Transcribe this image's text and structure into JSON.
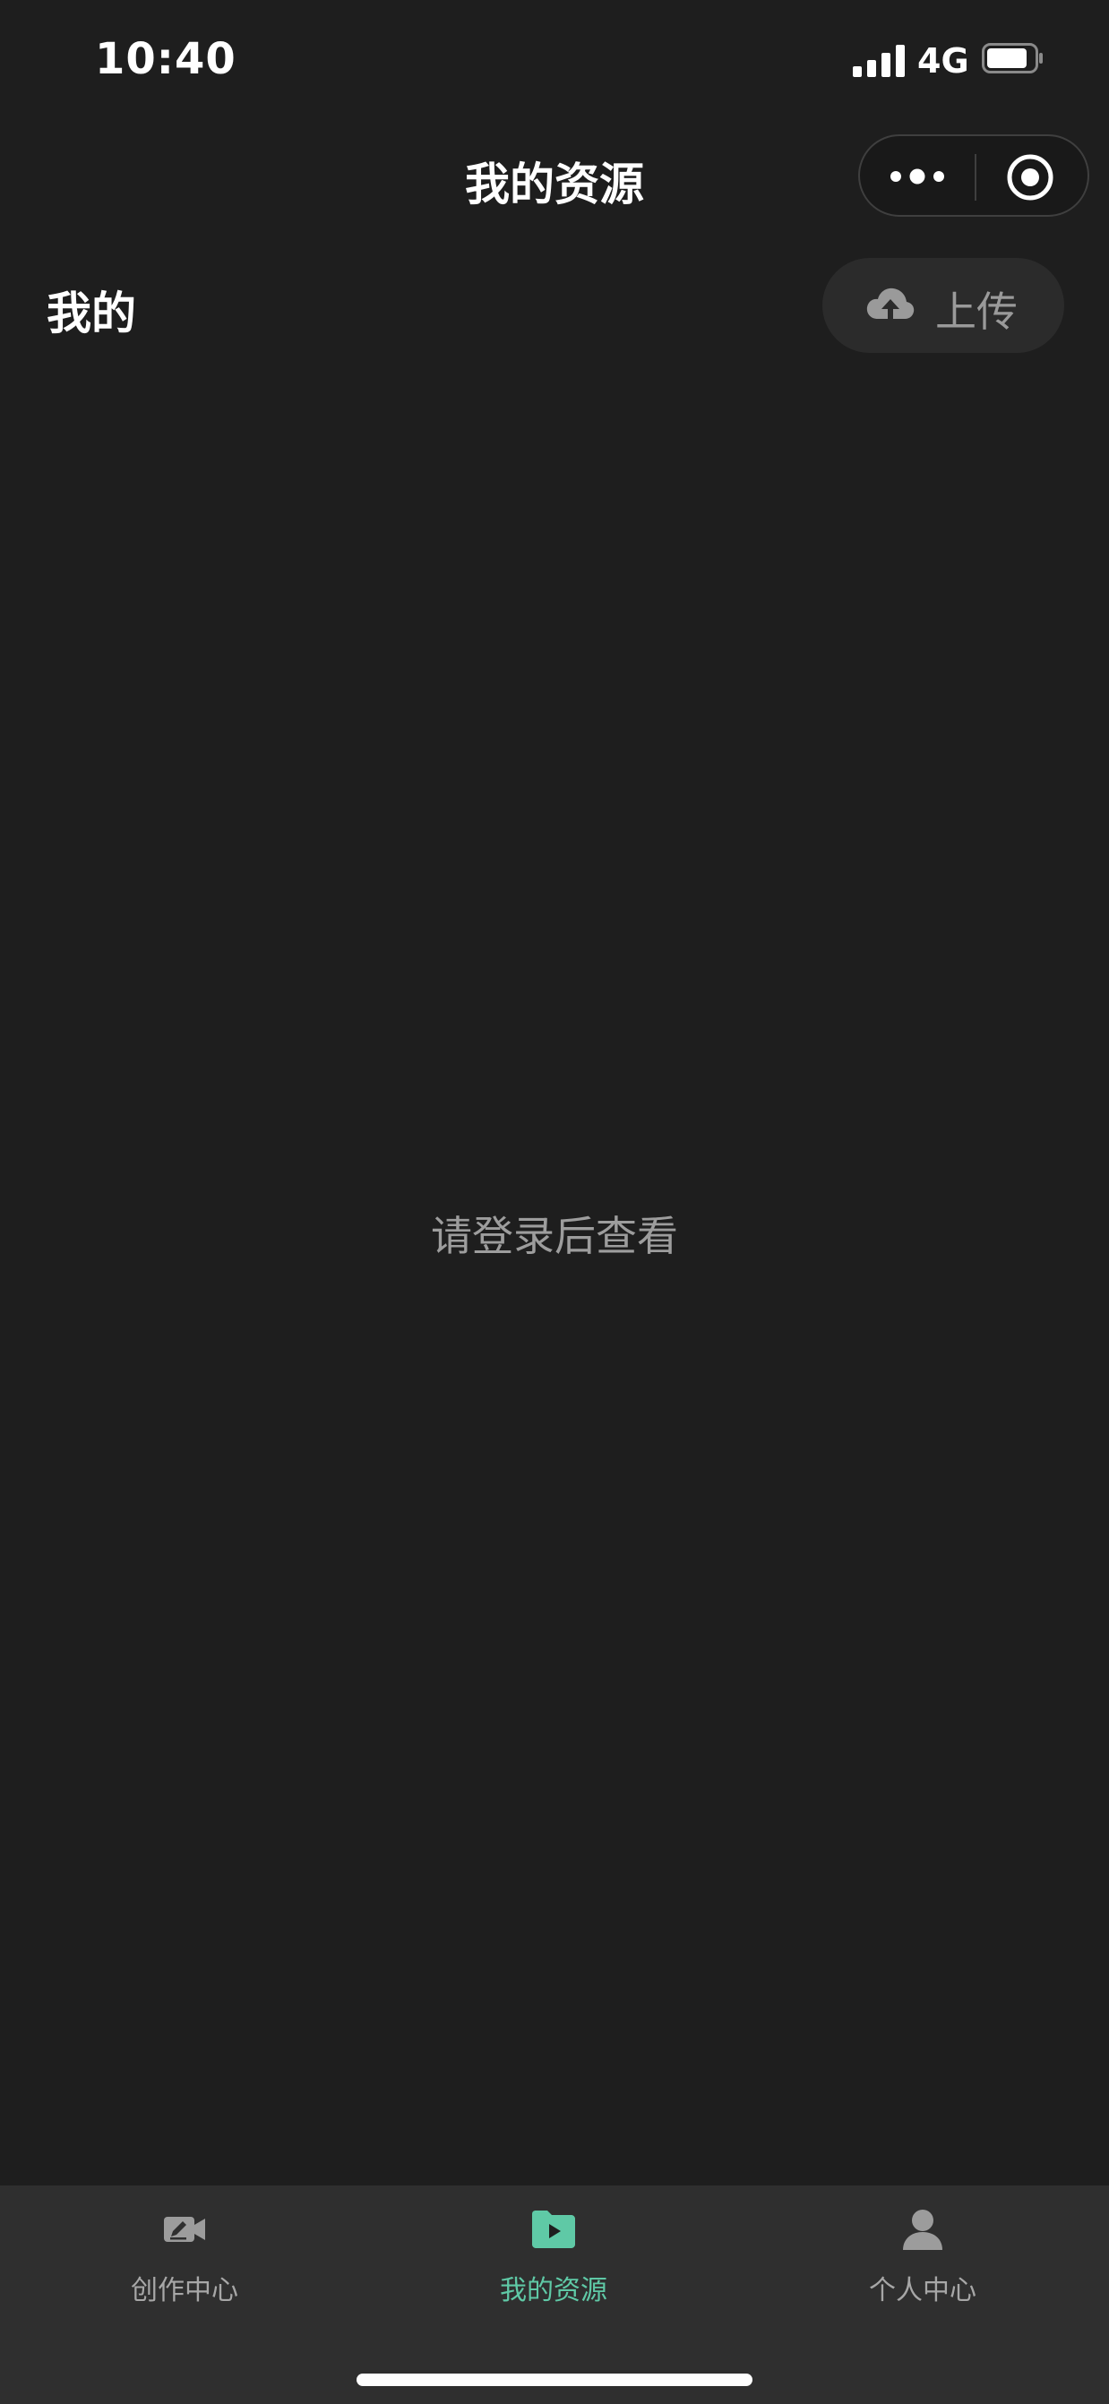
{
  "status_bar": {
    "time": "10:40",
    "network": "4G"
  },
  "header": {
    "title": "我的资源",
    "more_icon": "more-dots-icon",
    "close_icon": "target-circle-icon"
  },
  "section": {
    "title": "我的",
    "upload_label": "上传",
    "upload_icon": "cloud-upload-icon"
  },
  "main": {
    "empty_message": "请登录后查看"
  },
  "tabs": [
    {
      "label": "创作中心",
      "icon": "video-edit-icon",
      "active": false
    },
    {
      "label": "我的资源",
      "icon": "folder-play-icon",
      "active": true
    },
    {
      "label": "个人中心",
      "icon": "user-icon",
      "active": false
    }
  ],
  "colors": {
    "background": "#1e1e1e",
    "tab_bar": "#2f2f2f",
    "accent": "#5fc9a6",
    "inactive": "#a7a7a7"
  }
}
